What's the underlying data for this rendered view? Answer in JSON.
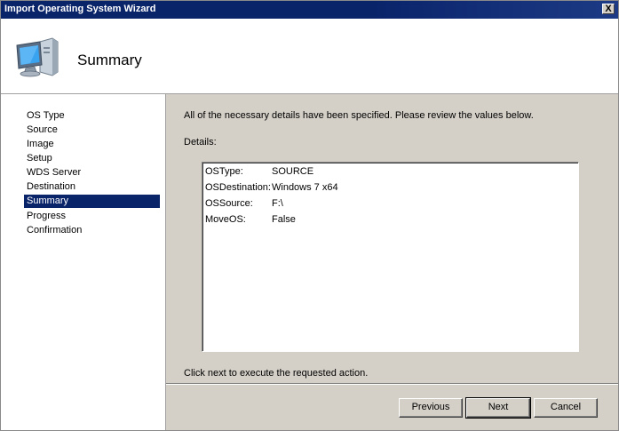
{
  "window": {
    "title": "Import Operating System Wizard",
    "close_label": "X"
  },
  "header": {
    "title": "Summary",
    "icon": "computer-monitor-icon"
  },
  "nav": {
    "items": [
      {
        "label": "OS Type"
      },
      {
        "label": "Source"
      },
      {
        "label": "Image"
      },
      {
        "label": "Setup"
      },
      {
        "label": "WDS Server"
      },
      {
        "label": "Destination"
      },
      {
        "label": "Summary",
        "selected": true
      },
      {
        "label": "Progress"
      },
      {
        "label": "Confirmation"
      }
    ]
  },
  "main": {
    "intro": "All of the necessary details have been specified.  Please review the values below.",
    "details_label": "Details:",
    "details": [
      {
        "key": "OSType:",
        "value": "SOURCE"
      },
      {
        "key": "OSDestination:",
        "value": "Windows 7 x64"
      },
      {
        "key": "OSSource:",
        "value": "F:\\"
      },
      {
        "key": "MoveOS:",
        "value": "False"
      }
    ],
    "footer": "Click next to execute the requested action."
  },
  "buttons": {
    "previous": "Previous",
    "next": "Next",
    "cancel": "Cancel"
  },
  "colors": {
    "titlebar": "#0a246a",
    "selection": "#0a246a",
    "panel": "#d4d0c8"
  }
}
